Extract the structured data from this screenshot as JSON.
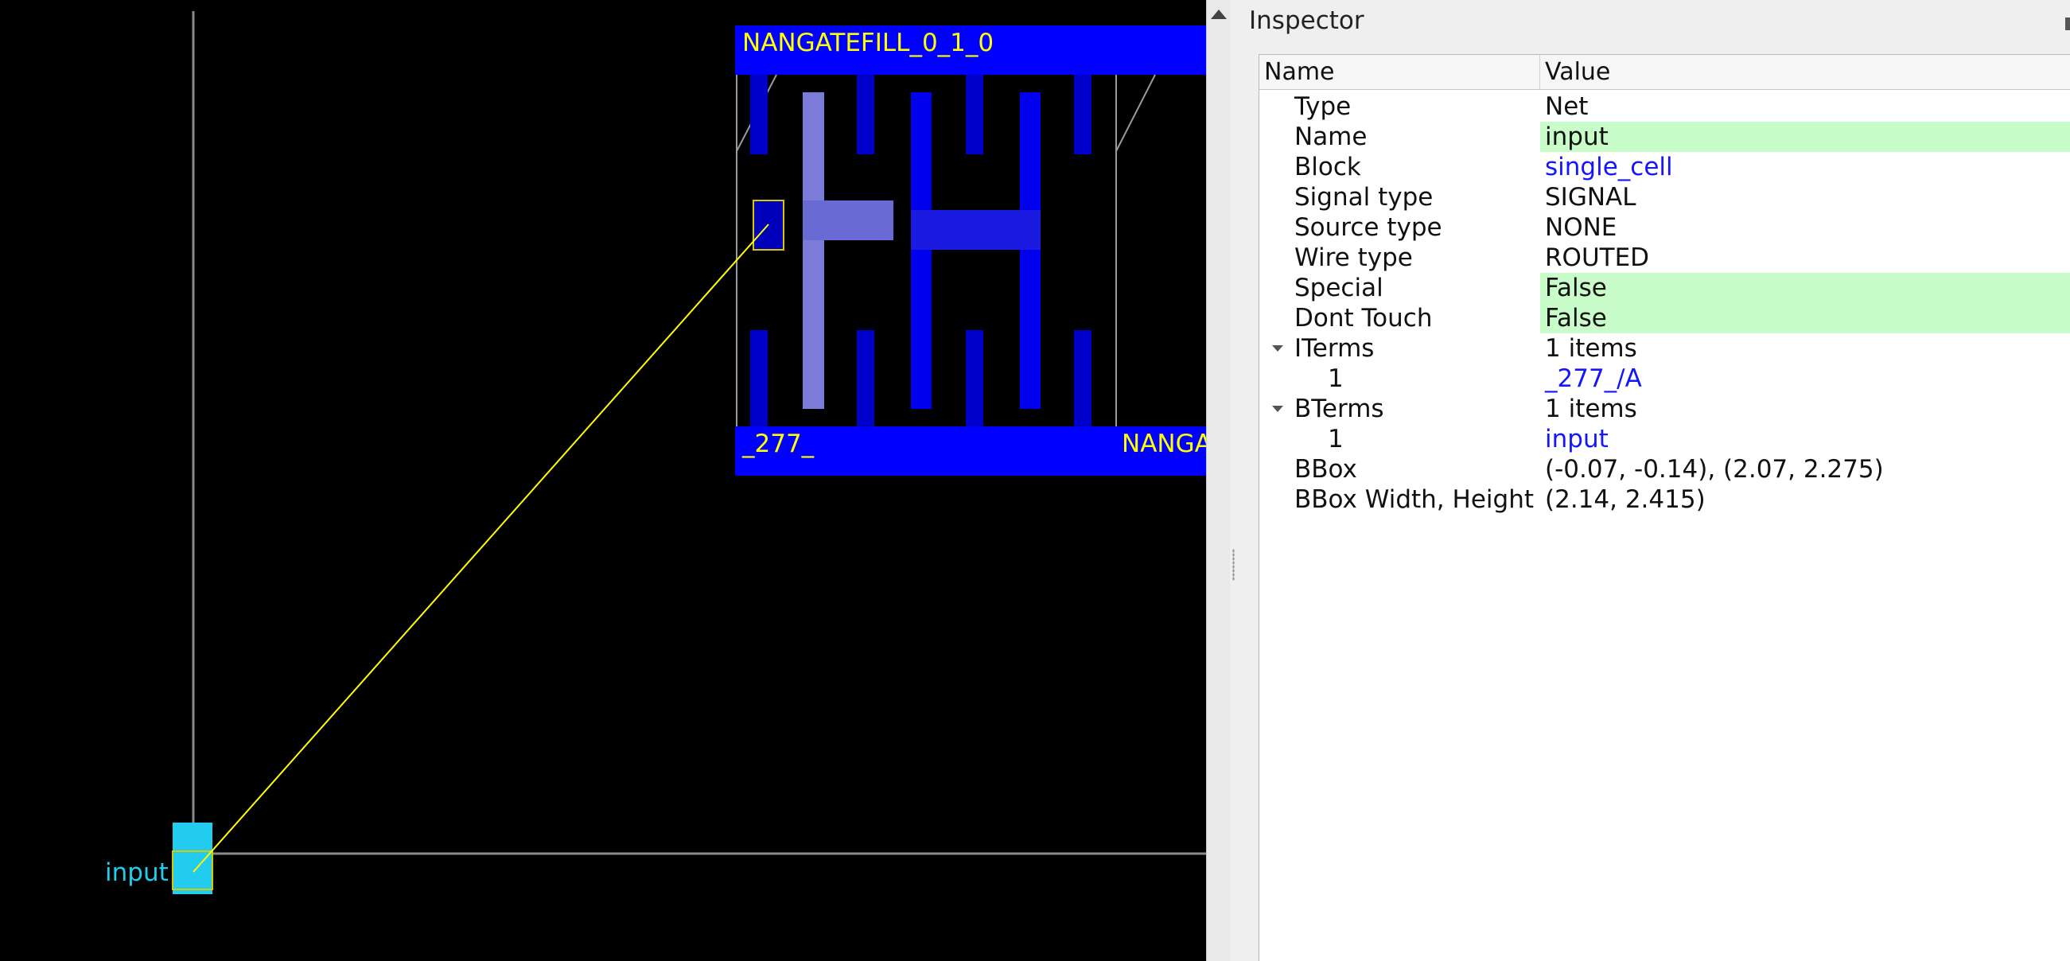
{
  "viewer": {
    "cell_top_label": "NANGATEFILL_0_1_0",
    "cell_bottom_label": "_277_",
    "cell_bottom_right_label": "NANGA",
    "pin_label": "input",
    "colors": {
      "background": "#000000",
      "metal": "#0000ff",
      "highlight": "#ffff00",
      "pin": "#22ccee"
    }
  },
  "inspector": {
    "title": "Inspector",
    "columns": {
      "name": "Name",
      "value": "Value"
    },
    "rows": [
      {
        "name": "Type",
        "value": "Net"
      },
      {
        "name": "Name",
        "value": "input"
      },
      {
        "name": "Block",
        "value": "single_cell"
      },
      {
        "name": "Signal type",
        "value": "SIGNAL"
      },
      {
        "name": "Source type",
        "value": "NONE"
      },
      {
        "name": "Wire type",
        "value": "ROUTED"
      },
      {
        "name": "Special",
        "value": "False"
      },
      {
        "name": "Dont Touch",
        "value": "False"
      },
      {
        "name": "ITerms",
        "value": "1 items"
      },
      {
        "name": "1",
        "value": "_277_/A"
      },
      {
        "name": "BTerms",
        "value": "1 items"
      },
      {
        "name": "1",
        "value": "input"
      },
      {
        "name": "BBox",
        "value": "(-0.07, -0.14), (2.07, 2.275)"
      },
      {
        "name": "BBox Width, Height",
        "value": "(2.14, 2.415)"
      }
    ],
    "colors": {
      "editable_bg": "#c8fcc8",
      "link": "#1515ff"
    }
  }
}
